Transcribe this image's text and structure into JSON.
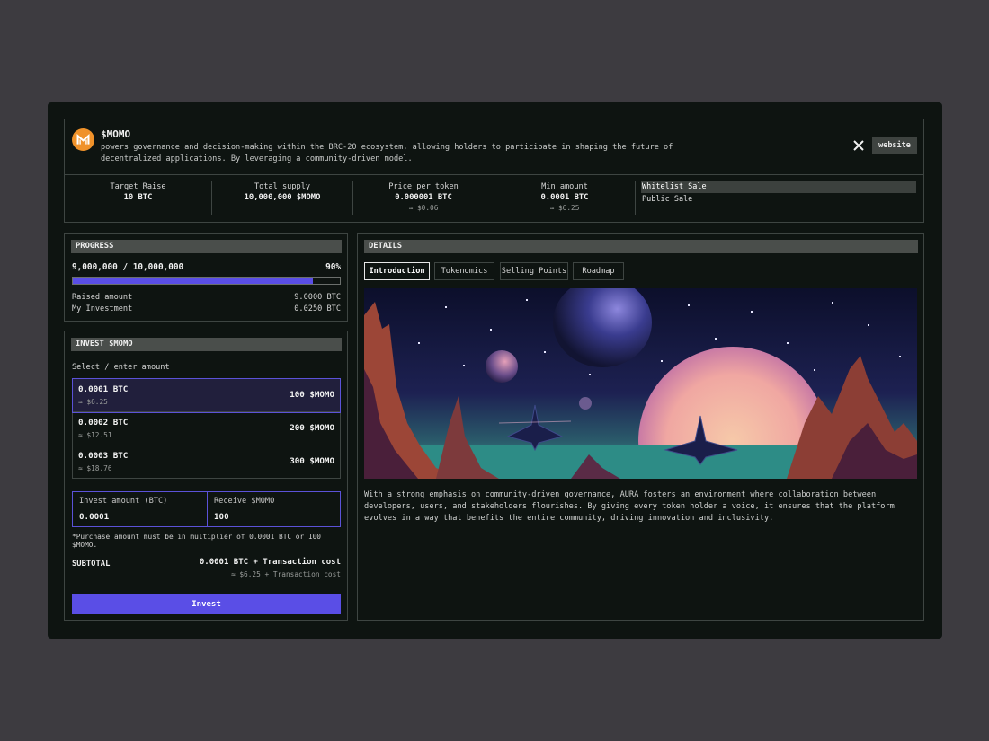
{
  "token": {
    "name": "$MOMO",
    "description": "powers governance and decision-making within the BRC-20 ecosystem, allowing holders to participate in shaping the future of decentralized applications. By leveraging a community-driven model.",
    "website_label": "website",
    "social_icon": "x-icon",
    "logo_icon": "momo-logo-icon",
    "brand_color": "#f0922a"
  },
  "stats": [
    {
      "label": "Target Raise",
      "value": "10 BTC",
      "sub": ""
    },
    {
      "label": "Total supply",
      "value": "10,000,000 $MOMO",
      "sub": ""
    },
    {
      "label": "Price per token",
      "value": "0.000001 BTC",
      "sub": "≈ $0.06"
    },
    {
      "label": "Min amount",
      "value": "0.0001 BTC",
      "sub": "≈ $6.25"
    }
  ],
  "sales": [
    {
      "label": "Whitelist Sale",
      "active": true
    },
    {
      "label": "Public Sale",
      "active": false
    }
  ],
  "progress": {
    "title": "PROGRESS",
    "count": "9,000,000 / 10,000,000",
    "percent_label": "90%",
    "fraction": 0.9,
    "raised_label": "Raised amount",
    "raised_value": "9.0000 BTC",
    "my_label": "My Investment",
    "my_value": "0.0250 BTC"
  },
  "invest": {
    "title": "INVEST $MOMO",
    "select_label": "Select / enter amount",
    "options": [
      {
        "btc": "0.0001 BTC",
        "usd": "≈ $6.25",
        "momo": "100 $MOMO",
        "selected": true
      },
      {
        "btc": "0.0002 BTC",
        "usd": "≈ $12.51",
        "momo": "200 $MOMO",
        "selected": false
      },
      {
        "btc": "0.0003 BTC",
        "usd": "≈ $18.76",
        "momo": "300 $MOMO",
        "selected": false
      }
    ],
    "amount_label": "Invest amount (BTC)",
    "amount_value": "0.0001",
    "receive_label": "Receive $MOMO",
    "receive_value": "100",
    "note": "*Purchase amount must be in multiplier of 0.0001 BTC or 100 $MOMO.",
    "subtotal_label": "SUBTOTAL",
    "subtotal_value": "0.0001 BTC + Transaction cost",
    "subtotal_sub": "≈ $6.25 + Transaction cost",
    "button_label": "Invest",
    "accent": "#5a4ee6"
  },
  "details": {
    "title": "DETAILS",
    "tabs": [
      {
        "label": "Introduction",
        "active": true
      },
      {
        "label": "Tokenomics",
        "active": false
      },
      {
        "label": "Selling Points",
        "active": false
      },
      {
        "label": "Roadmap",
        "active": false
      }
    ],
    "text": "With a strong emphasis on community-driven governance, AURA fosters an environment where collaboration between developers, users, and stakeholders flourishes. By giving every token holder a voice, it ensures that the platform evolves in a way that benefits the entire community, driving innovation and inclusivity."
  }
}
